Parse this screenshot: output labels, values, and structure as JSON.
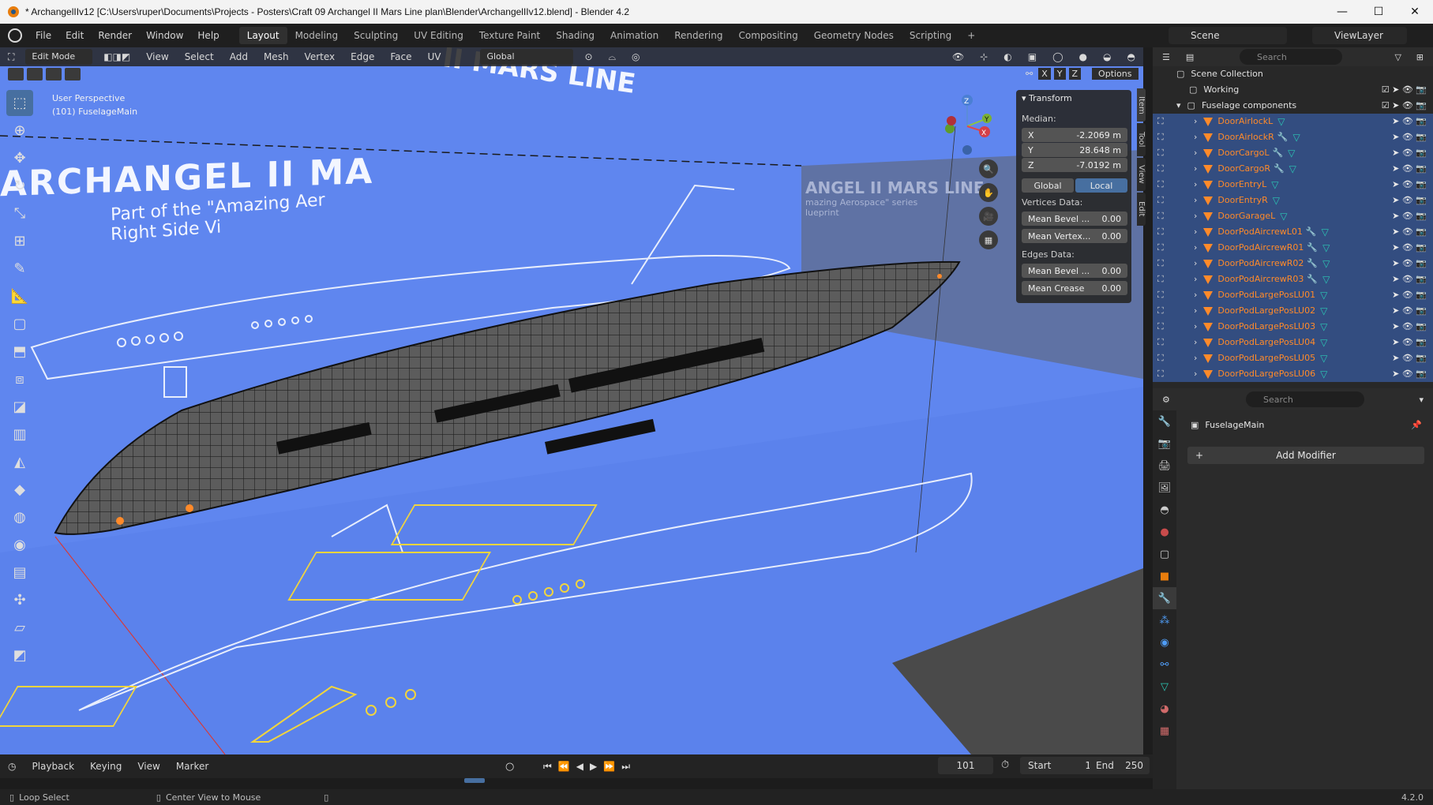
{
  "window": {
    "title": "* ArchangelIIv12 [C:\\Users\\ruper\\Documents\\Projects - Posters\\Craft 09 Archangel II Mars Line plan\\Blender\\ArchangelIIv12.blend] - Blender 4.2",
    "min": "—",
    "max": "☐",
    "close": "✕"
  },
  "menu": [
    "File",
    "Edit",
    "Render",
    "Window",
    "Help"
  ],
  "workspace_tabs": [
    "Layout",
    "Modeling",
    "Sculpting",
    "UV Editing",
    "Texture Paint",
    "Shading",
    "Animation",
    "Rendering",
    "Compositing",
    "Geometry Nodes",
    "Scripting"
  ],
  "add_tab": "+",
  "scene": "Scene",
  "view_layer": "ViewLayer",
  "viewport_header": {
    "mode": "Edit Mode",
    "menus": [
      "View",
      "Select",
      "Add",
      "Mesh",
      "Vertex",
      "Edge",
      "Face",
      "UV"
    ],
    "orientation": "Global",
    "options": "Options",
    "axes": [
      "X",
      "Y",
      "Z"
    ]
  },
  "viewport_info": {
    "perspective": "User Perspective",
    "object": "(101) FuselageMain"
  },
  "blueprint_text": {
    "title": "ARCHANGEL II MA",
    "subtitle1": "Part of the \"Amazing Aer",
    "subtitle2": "Right Side Vi",
    "top": "II MARS LINE",
    "top2": "Amazing Aerospace\" series",
    "right_title": "ANGEL II MARS LINE",
    "right_sub": "mazing Aerospace\" series",
    "right_sub2": "lueprint"
  },
  "npanel": {
    "section": "Transform",
    "median_label": "Median:",
    "fields": [
      {
        "axis": "X",
        "value": "-2.2069 m"
      },
      {
        "axis": "Y",
        "value": "28.648 m"
      },
      {
        "axis": "Z",
        "value": "-7.0192 m"
      }
    ],
    "global": "Global",
    "local": "Local",
    "vertices_label": "Vertices Data:",
    "vertices_fields": [
      {
        "label": "Mean Bevel ...",
        "value": "0.00"
      },
      {
        "label": "Mean Vertex...",
        "value": "0.00"
      }
    ],
    "edges_label": "Edges Data:",
    "edges_fields": [
      {
        "label": "Mean Bevel ...",
        "value": "0.00"
      },
      {
        "label": "Mean Crease",
        "value": "0.00"
      }
    ],
    "tabs": [
      "Item",
      "Tool",
      "View",
      "Edit"
    ]
  },
  "gizmo": {
    "z": "Z",
    "y": "Y",
    "x": "X"
  },
  "outliner": {
    "search_placeholder": "Search",
    "collection_root": "Scene Collection",
    "collections": [
      "Working",
      "Fuselage components"
    ],
    "objects": [
      {
        "name": "DoorAirlockL",
        "wrench": false
      },
      {
        "name": "DoorAirlockR",
        "wrench": true
      },
      {
        "name": "DoorCargoL",
        "wrench": true
      },
      {
        "name": "DoorCargoR",
        "wrench": true
      },
      {
        "name": "DoorEntryL",
        "wrench": false
      },
      {
        "name": "DoorEntryR",
        "wrench": false
      },
      {
        "name": "DoorGarageL",
        "wrench": false
      },
      {
        "name": "DoorPodAircrewL01",
        "wrench": true
      },
      {
        "name": "DoorPodAircrewR01",
        "wrench": true
      },
      {
        "name": "DoorPodAircrewR02",
        "wrench": true
      },
      {
        "name": "DoorPodAircrewR03",
        "wrench": true
      },
      {
        "name": "DoorPodLargePosLU01",
        "wrench": false
      },
      {
        "name": "DoorPodLargePosLU02",
        "wrench": false
      },
      {
        "name": "DoorPodLargePosLU03",
        "wrench": false
      },
      {
        "name": "DoorPodLargePosLU04",
        "wrench": false
      },
      {
        "name": "DoorPodLargePosLU05",
        "wrench": false
      },
      {
        "name": "DoorPodLargePosLU06",
        "wrench": false
      }
    ]
  },
  "properties": {
    "search_placeholder": "Search",
    "object_name": "FuselageMain",
    "add_modifier": "Add Modifier"
  },
  "timeline": {
    "playback": "Playback",
    "keying": "Keying",
    "view": "View",
    "marker": "Marker",
    "current_frame": "101",
    "start_label": "Start",
    "start": "1",
    "end_label": "End",
    "end": "250"
  },
  "statusbar": {
    "left_action": "Loop Select",
    "mid_action": "Center View to Mouse",
    "version": "4.2.0"
  },
  "colors": {
    "accent": "#476fa0",
    "selection": "#334d80",
    "object_name": "#ff8a2a",
    "viewport_bg": "#6c8ff0",
    "blueprint_yellow": "#f2d53c"
  }
}
